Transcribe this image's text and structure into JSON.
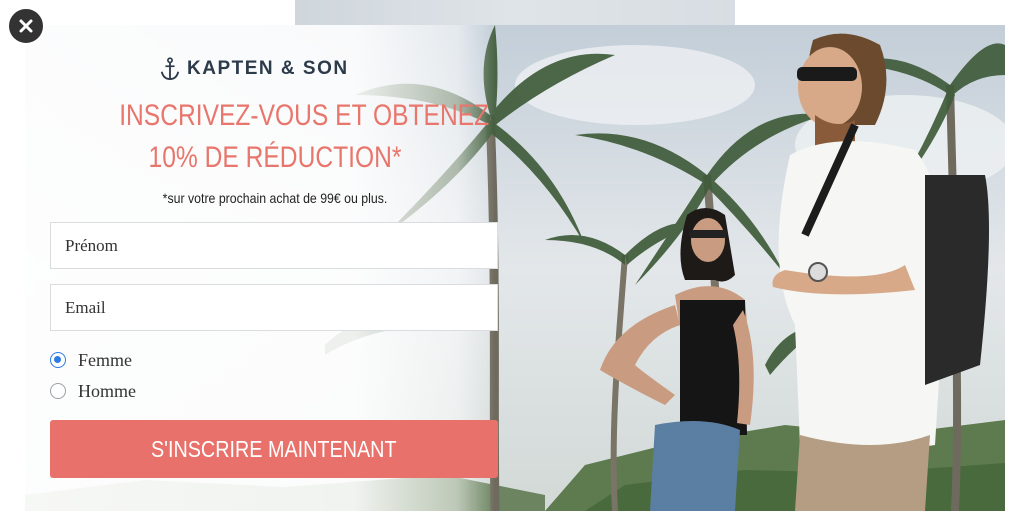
{
  "popup": {
    "brand": "KAPTEN & SON",
    "headline_line1": "INSCRIVEZ-VOUS ET OBTENEZ",
    "headline_line2": "10% DE RÉDUCTION*",
    "subtext": "*sur votre prochain achat de 99€ ou plus.",
    "first_name_placeholder": "Prénom",
    "email_placeholder": "Email",
    "gender_options": [
      {
        "label": "Femme",
        "selected": true
      },
      {
        "label": "Homme",
        "selected": false
      }
    ],
    "submit_label": "S'INSCRIRE MAINTENANT"
  },
  "colors": {
    "accent": "#e8726b",
    "headline": "#e8766c",
    "brand": "#2c3a4a",
    "radio_selected": "#2d7be5"
  },
  "icons": [
    "close-icon",
    "anchor-icon"
  ]
}
